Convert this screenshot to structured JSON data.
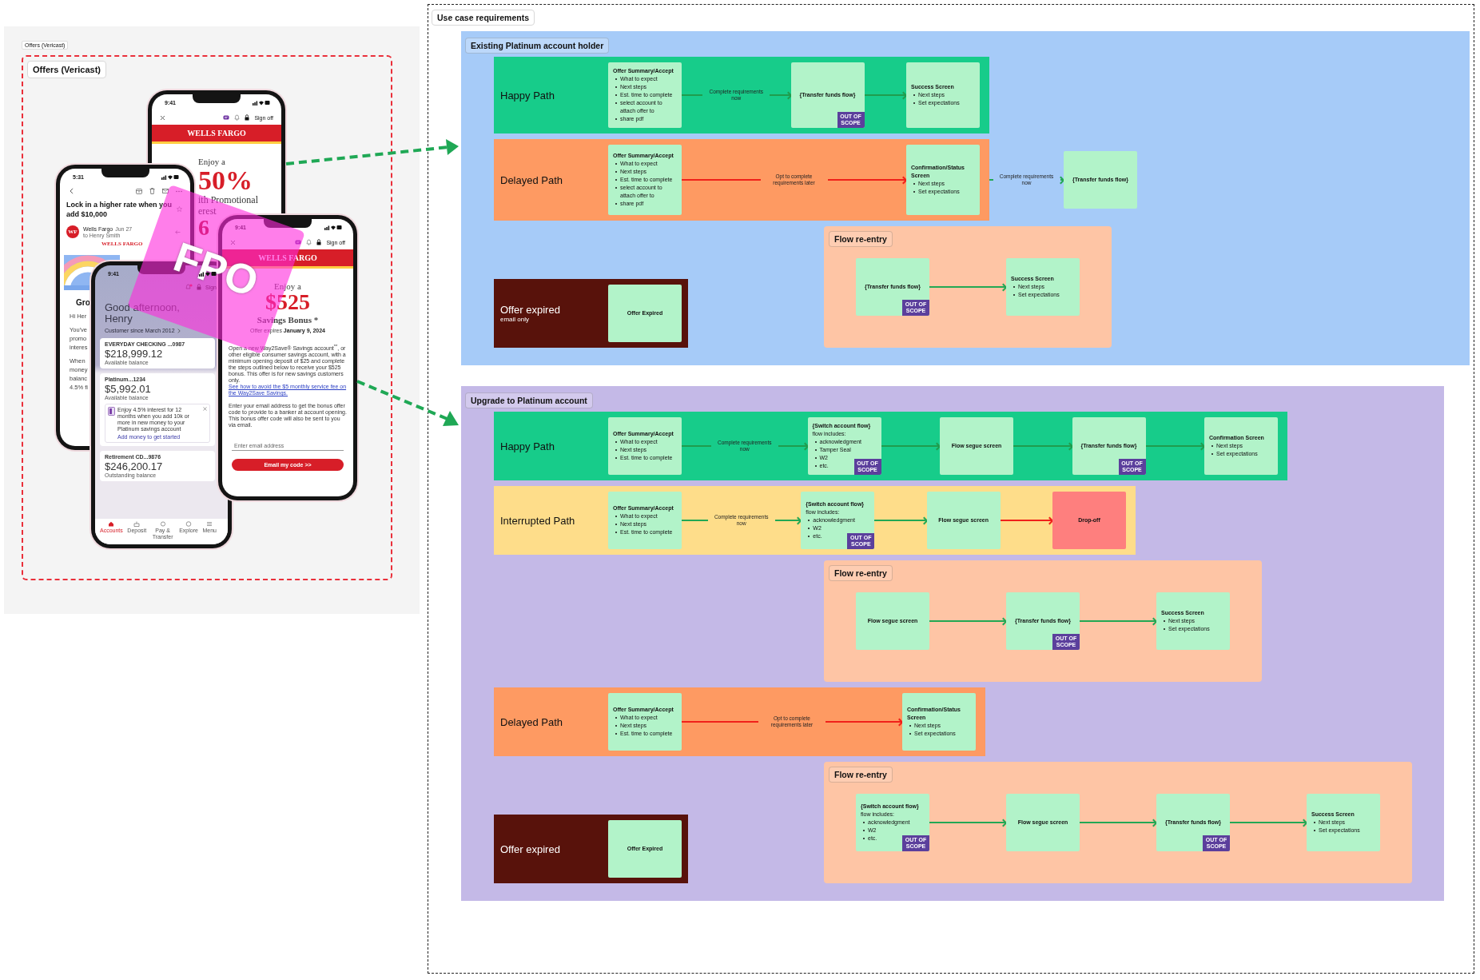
{
  "offers": {
    "caption": "Offers (Vericast)",
    "title": "Offers (Vericast)",
    "phones": [
      {
        "kind": "offer_rate",
        "time": "9:41",
        "sign_off": "Sign off",
        "brand": "WELLS FARGO",
        "headline": "Enjoy a",
        "figure": "50%",
        "fragments": [
          "ith Promotional",
          "erest"
        ],
        "digit": "6"
      },
      {
        "kind": "email",
        "time": "5:31",
        "subject": "Lock in a higher rate when you add $10,000",
        "avatar": "WF",
        "sender": "Wells Fargo",
        "date": "Jun 27",
        "recipient": "to Henry Smith",
        "brand": "WELLS FARGO",
        "heading": "Gro",
        "paragraphs": [
          [
            "Hi Her"
          ],
          [
            "You've",
            "promo",
            "interes"
          ],
          [
            "When",
            "money",
            "balanc",
            "4.5% fi"
          ]
        ]
      },
      {
        "kind": "accounts",
        "time": "9:41",
        "sign_off": "Sign",
        "greeting": "Good afternoon, Henry",
        "since": "Customer since March 2012",
        "accounts": [
          {
            "name": "EVERYDAY CHECKING ...0987",
            "amount": "$218,999.12",
            "caption": "Available balance"
          },
          {
            "name": "Platinum...1234",
            "amount": "$5,992.01",
            "caption": "Available balance",
            "promo": {
              "text": "Enjoy 4.5% interest for 12 months when you add 10k or more in new money to your Platinum savings account",
              "link": "Add money to get started"
            }
          },
          {
            "name": "Retirement CD...9876",
            "amount": "$246,200.17",
            "caption": "Outstanding balance"
          }
        ],
        "tabs": [
          {
            "label": "Accounts",
            "selected": true
          },
          {
            "label": "Deposit",
            "selected": false
          },
          {
            "label": "Pay & Transfer",
            "selected": false
          },
          {
            "label": "Explore",
            "selected": false
          },
          {
            "label": "Menu",
            "selected": false
          }
        ]
      },
      {
        "kind": "offer_bonus",
        "time": "9:41",
        "sign_off": "Sign off",
        "brand": "WELLS FARGO",
        "headline": "Enjoy a",
        "figure": "$525",
        "subtitle": "Savings Bonus *",
        "expiry": "Offer expires **January 9, 2024**",
        "body": "Open a new Way2Save® Savings account$^{**}$, or other eligible consumer savings account, with a minimum opening deposit of $25 and complete the steps outlined below to receive your $525 bonus. This offer is for new savings customers only.",
        "link": "See how to avoid the $5 monthly service fee on the Way2Save Savings.",
        "body2": "Enter your email address to get the bonus offer code to provide to a banker at account opening. This bonus offer code will also be sent to you via email.",
        "email_placeholder": "Enter email address",
        "button": "Email my code >>"
      }
    ],
    "sticker": "FPO"
  },
  "requirements": {
    "title": "Use case requirements",
    "sections": [
      {
        "title": "Existing Platinum account holder",
        "color": "#a6cbf8",
        "items": [
          {
            "kind": "lane",
            "label": "Happy Path",
            "color": "#17cc8a",
            "nodes": [
              {
                "kind": "screen",
                "title": "Offer Summary/Accept",
                "bullets": [
                  "What to expect",
                  "Next steps",
                  "Est. time to complete",
                  "select account to attach offer to",
                  "share pdf"
                ]
              },
              {
                "kind": "screen",
                "title": "{Transfer funds flow}",
                "badge": "OUT OF SCOPE",
                "link": {
                  "label": "Complete requirements now",
                  "color": "#1f9d4e"
                }
              },
              {
                "kind": "screen",
                "title": "Success Screen",
                "bullets": [
                  "Next steps",
                  "Set expectations"
                ],
                "link": {
                  "color": "#1f9d4e"
                }
              }
            ]
          },
          {
            "kind": "lane",
            "label": "Delayed Path",
            "color": "#fe9a62",
            "nodes": [
              {
                "kind": "screen",
                "title": "Offer Summary/Accept",
                "bullets": [
                  "What to expect",
                  "Next steps",
                  "Est. time to complete",
                  "select account to attach offer to",
                  "share pdf"
                ]
              },
              {
                "kind": "screen",
                "title": "Confirmation/Status Screen",
                "bullets": [
                  "Next steps",
                  "Set expectations"
                ],
                "link": {
                  "label": "Opt to complete requirements later",
                  "color": "#f0211a"
                }
              }
            ],
            "beyond": [
              {
                "kind": "screen",
                "title": "{Transfer funds flow}",
                "link": {
                  "label": "Complete requirements now",
                  "color": "#22a854"
                }
              }
            ]
          },
          {
            "kind": "reentry",
            "title": "Flow re-entry",
            "nodes": [
              {
                "kind": "screen",
                "title": "{Transfer funds flow}",
                "badge": "OUT OF SCOPE"
              },
              {
                "kind": "screen",
                "title": "Success Screen",
                "bullets": [
                  "Next steps",
                  "Set expectations"
                ],
                "link": {
                  "color": "#22a854"
                }
              }
            ]
          },
          {
            "kind": "lane",
            "label": "Offer expired",
            "sublabel": "email only",
            "color": "#58120b",
            "nodes": [
              {
                "kind": "screen",
                "title": "Offer Expired"
              }
            ]
          }
        ]
      },
      {
        "title": "Upgrade to Platinum account",
        "color": "#c4b9e7",
        "items": [
          {
            "kind": "lane",
            "label": "Happy Path",
            "color": "#17cc8a",
            "nodes": [
              {
                "kind": "screen",
                "title": "Offer Summary/Accept",
                "bullets": [
                  "What to expect",
                  "Next steps",
                  "Est. time to complete"
                ]
              },
              {
                "kind": "screen",
                "title": "{Switch account flow}",
                "subtitle": "flow includes:",
                "bullets": [
                  "acknowledgment",
                  "Tamper Seal",
                  "W2",
                  "etc."
                ],
                "badge": "OUT OF SCOPE",
                "link": {
                  "label": "Complete requirements now",
                  "color": "#1f9d4e"
                }
              },
              {
                "kind": "screen",
                "title": "Flow segue screen",
                "link": {
                  "color": "#1f9d4e"
                }
              },
              {
                "kind": "screen",
                "title": "{Transfer funds flow}",
                "badge": "OUT OF SCOPE",
                "link": {
                  "color": "#1f9d4e"
                }
              },
              {
                "kind": "screen",
                "title": "Confirmation Screen",
                "bullets": [
                  "Next steps",
                  "Set expectations"
                ],
                "link": {
                  "color": "#1f9d4e"
                }
              }
            ]
          },
          {
            "kind": "lane",
            "label": "Interrupted Path",
            "color": "#fedd8a",
            "nodes": [
              {
                "kind": "screen",
                "title": "Offer Summary/Accept",
                "bullets": [
                  "What to expect",
                  "Next steps",
                  "Est. time to complete"
                ]
              },
              {
                "kind": "screen",
                "title": "{Switch account flow}",
                "subtitle": "flow includes:",
                "bullets": [
                  "acknowledgment",
                  "W2",
                  "etc."
                ],
                "badge": "OUT OF SCOPE",
                "link": {
                  "label": "Complete requirements now",
                  "color": "#22a854"
                }
              },
              {
                "kind": "screen",
                "title": "Flow segue screen",
                "link": {
                  "color": "#22a854"
                }
              },
              {
                "kind": "dropoff",
                "title": "Drop-off",
                "link": {
                  "color": "#f0211a"
                }
              }
            ]
          },
          {
            "kind": "reentry",
            "title": "Flow re-entry",
            "nodes": [
              {
                "kind": "screen",
                "title": "Flow segue screen"
              },
              {
                "kind": "screen",
                "title": "{Transfer funds flow}",
                "badge": "OUT OF SCOPE",
                "link": {
                  "color": "#22a854"
                }
              },
              {
                "kind": "screen",
                "title": "Success Screen",
                "bullets": [
                  "Next steps",
                  "Set expectations"
                ],
                "link": {
                  "color": "#22a854"
                }
              }
            ]
          },
          {
            "kind": "lane",
            "label": "Delayed Path",
            "color": "#fe9a62",
            "nodes": [
              {
                "kind": "screen",
                "title": "Offer Summary/Accept",
                "bullets": [
                  "What to expect",
                  "Next steps",
                  "Est. time to complete"
                ]
              },
              {
                "kind": "screen",
                "title": "Confirmation/Status Screen",
                "bullets": [
                  "Next steps",
                  "Set expectations"
                ],
                "link": {
                  "label": "Opt to complete requirements later",
                  "color": "#f0211a"
                }
              }
            ]
          },
          {
            "kind": "reentry",
            "title": "Flow re-entry",
            "nodes": [
              {
                "kind": "screen",
                "title": "{Switch account flow}",
                "subtitle": "flow includes:",
                "bullets": [
                  "acknowledgment",
                  "W2",
                  "etc."
                ],
                "badge": "OUT OF SCOPE"
              },
              {
                "kind": "screen",
                "title": "Flow segue screen",
                "link": {
                  "color": "#22a854"
                }
              },
              {
                "kind": "screen",
                "title": "{Transfer funds flow}",
                "badge": "OUT OF SCOPE",
                "link": {
                  "color": "#22a854"
                }
              },
              {
                "kind": "screen",
                "title": "Success Screen",
                "bullets": [
                  "Next steps",
                  "Set expectations"
                ],
                "link": {
                  "color": "#22a854"
                }
              }
            ]
          },
          {
            "kind": "lane",
            "label": "Offer expired",
            "color": "#58120b",
            "nodes": [
              {
                "kind": "screen",
                "title": "Offer Expired"
              }
            ]
          }
        ]
      }
    ]
  }
}
